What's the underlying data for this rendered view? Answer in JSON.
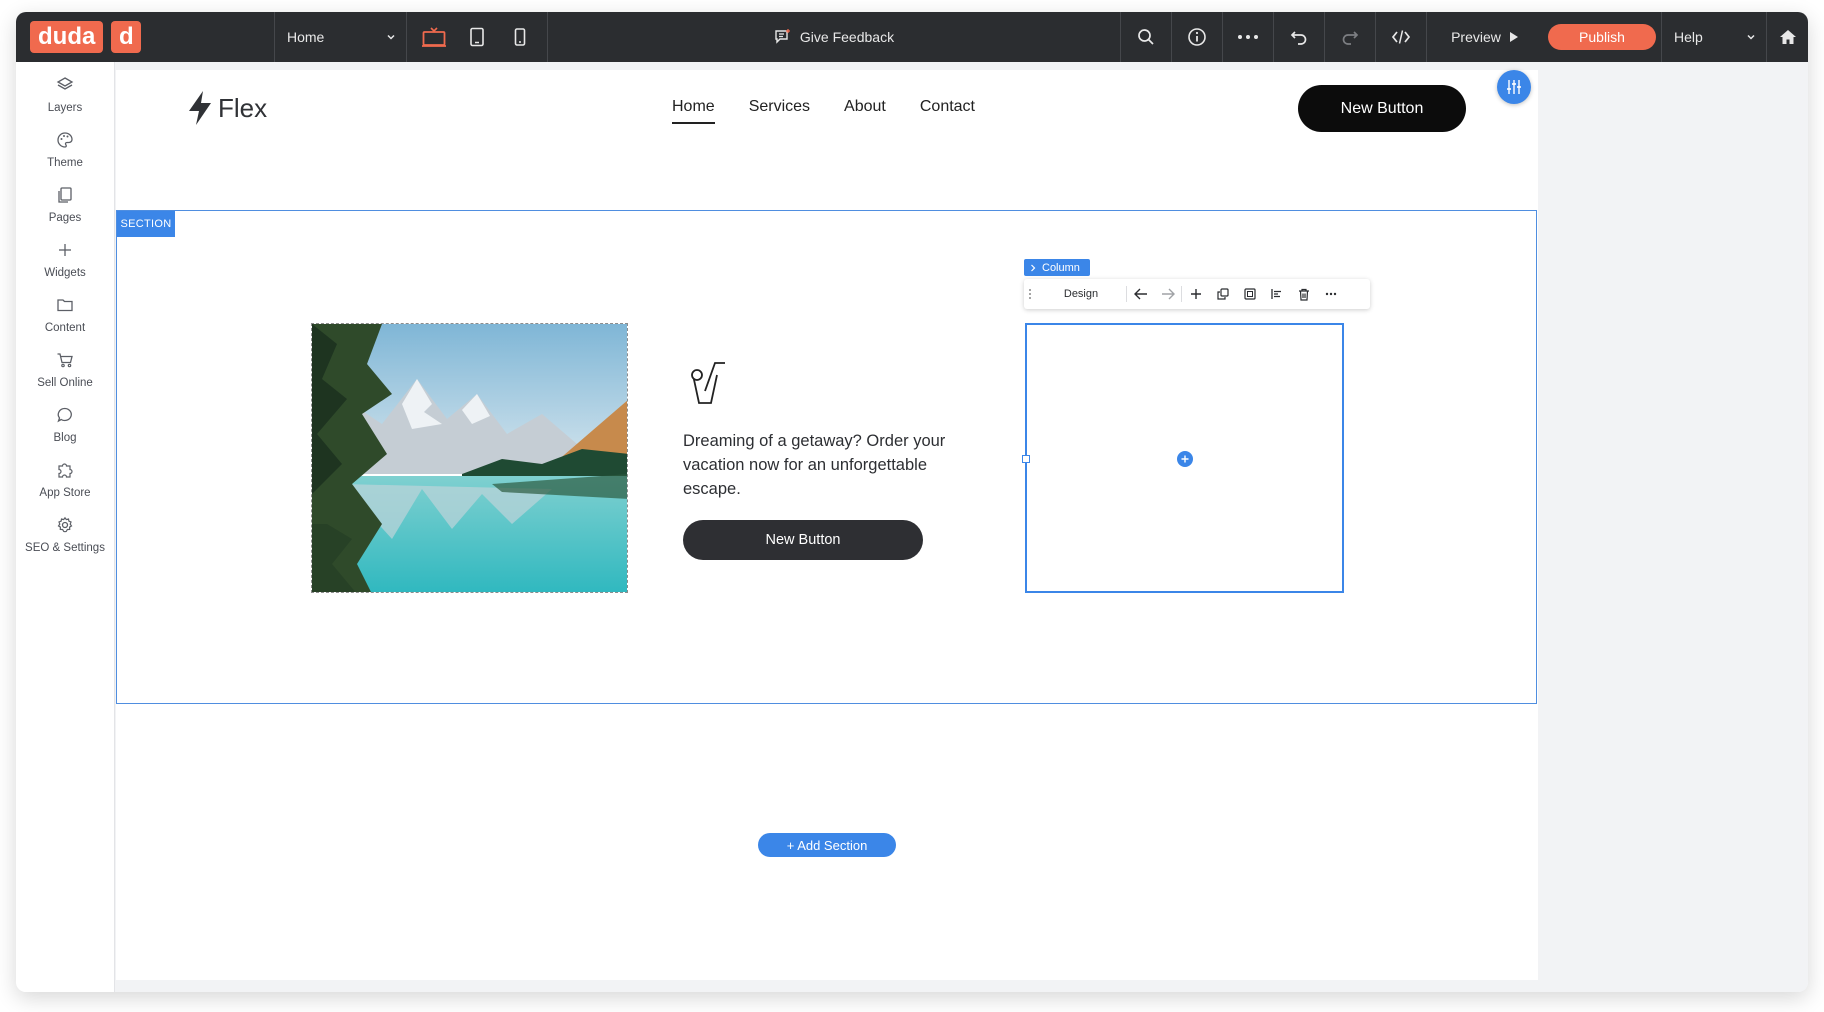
{
  "brand": {
    "logo_text": "duda",
    "logo_short": "d",
    "accent": "#f06a4e",
    "selection_blue": "#3b86e8"
  },
  "topbar": {
    "page_select": "Home",
    "devices": [
      "desktop-icon",
      "tablet-icon",
      "mobile-icon"
    ],
    "feedback_label": "Give Feedback",
    "preview_label": "Preview",
    "publish_label": "Publish",
    "help_label": "Help"
  },
  "sidebar": {
    "items": [
      {
        "label": "Layers",
        "icon": "layers-icon"
      },
      {
        "label": "Theme",
        "icon": "palette-icon"
      },
      {
        "label": "Pages",
        "icon": "pages-icon"
      },
      {
        "label": "Widgets",
        "icon": "plus-icon"
      },
      {
        "label": "Content",
        "icon": "folder-icon"
      },
      {
        "label": "Sell Online",
        "icon": "cart-icon"
      },
      {
        "label": "Blog",
        "icon": "chat-bubble-icon"
      },
      {
        "label": "App Store",
        "icon": "puzzle-icon"
      },
      {
        "label": "SEO & Settings",
        "icon": "gear-icon"
      }
    ]
  },
  "site": {
    "logo_text": "Flex",
    "nav": [
      "Home",
      "Services",
      "About",
      "Contact"
    ],
    "nav_active": "Home",
    "header_button": "New Button"
  },
  "section": {
    "tag": "SECTION",
    "text": "Dreaming of a getaway? Order your vacation now for an unforgettable escape.",
    "button": "New Button",
    "column_tag": "Column",
    "toolbar_design": "Design",
    "add_section": "+ Add Section"
  }
}
